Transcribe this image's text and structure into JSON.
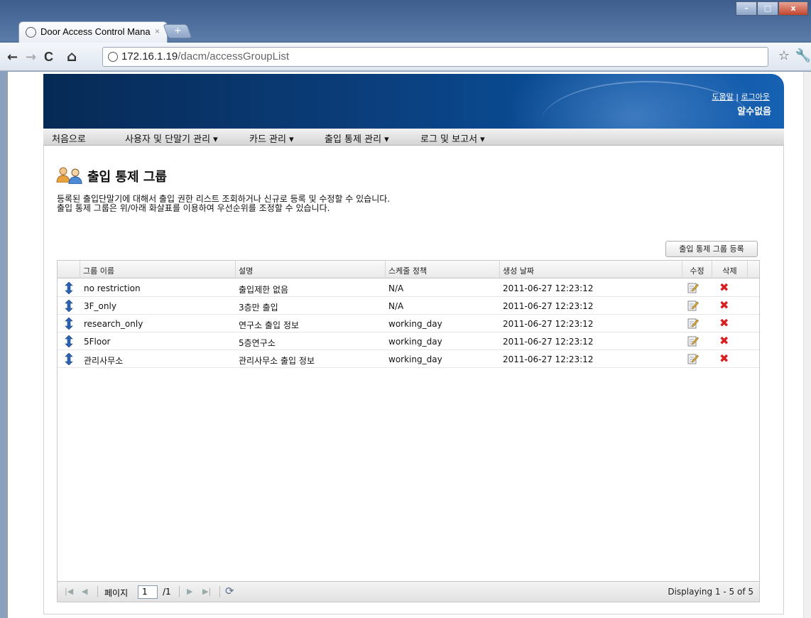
{
  "browser": {
    "tab_title": "Door Access Control Mana",
    "tab_close": "×",
    "new_tab": "+",
    "url_host": "172.16.1.19",
    "url_path": "/dacm/accessGroupList",
    "back": "←",
    "forward": "→",
    "reload": "C",
    "home": "⌂",
    "star": "☆",
    "wrench": "🔧",
    "win_minimize": "–",
    "win_maximize": "□",
    "win_close": "x"
  },
  "header": {
    "help_link": "도움말",
    "divider": "|",
    "logout_link": "로그아웃",
    "username": "알수없음"
  },
  "menu": [
    {
      "label": "처음으로"
    },
    {
      "label": "사용자 및 단말기 관리 ▾"
    },
    {
      "label": "카드 관리 ▾"
    },
    {
      "label": "출입 통제 관리 ▾"
    },
    {
      "label": "로그 및 보고서 ▾"
    }
  ],
  "page": {
    "title": "출입 통제 그룹",
    "desc_line1": "등록된 출입단말기에 대해서 출입 권한 리스트 조회하거나 신규로 등록 및 수정할 수 있습니다.",
    "desc_line2": "출입 통제 그룹은 위/아래 화살표를 이용하여 우선순위를 조정할 수 있습니다.",
    "register_button": "출입 통제 그룹 등록"
  },
  "table": {
    "columns": [
      "그룹 이름",
      "설명",
      "스케줄 정책",
      "생성 날짜",
      "수정",
      "삭제"
    ],
    "rows": [
      {
        "name": "no restriction",
        "desc": "출입제한 없음",
        "schedule": "N/A",
        "created": "2011-06-27 12:23:12"
      },
      {
        "name": "3F_only",
        "desc": "3층만 출입",
        "schedule": "N/A",
        "created": "2011-06-27 12:23:12"
      },
      {
        "name": "research_only",
        "desc": "연구소 출입 정보",
        "schedule": "working_day",
        "created": "2011-06-27 12:23:12"
      },
      {
        "name": "5Floor",
        "desc": "5층연구소",
        "schedule": "working_day",
        "created": "2011-06-27 12:23:12"
      },
      {
        "name": "관리사무소",
        "desc": "관리사무소 출입 정보",
        "schedule": "working_day",
        "created": "2011-06-27 12:23:12"
      }
    ],
    "delete_glyph": "✖"
  },
  "pager": {
    "first": "|◀",
    "prev": "◀",
    "page_label": "페이지",
    "page_value": "1",
    "total_pages": "/1",
    "next": "▶",
    "last": "▶|",
    "refresh": "⟳",
    "display_text": "Displaying 1 - 5 of 5"
  },
  "colors": {
    "banner_dark": "#062a55",
    "banner_light": "#1761b3",
    "delete_red": "#d81e1e"
  }
}
